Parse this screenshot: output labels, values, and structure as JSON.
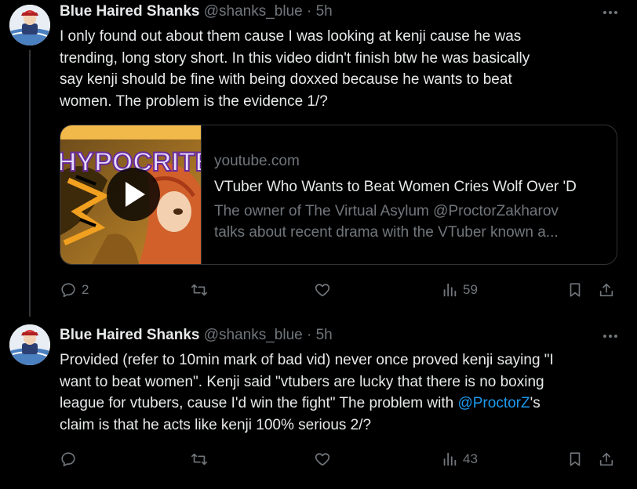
{
  "tweets": [
    {
      "author_name": "Blue Haired Shanks",
      "handle": "@shanks_blue",
      "separator": "·",
      "time": "5h",
      "text_lines": [
        "I only found out about them cause I was looking at kenji cause he was",
        "trending, long story short. In this video didn't finish btw he was basically",
        "say kenji should be fine with being doxxed because he wants to beat",
        "women. The problem is the evidence 1/?"
      ],
      "card": {
        "thumbnail_text": "HYPOCRITE",
        "domain": "youtube.com",
        "title": "VTuber Who Wants to Beat Women Cries Wolf Over 'D",
        "description_lines": [
          "The owner of The Virtual Asylum @ProctorZakharov",
          "talks about recent drama with the VTuber known a..."
        ]
      },
      "replies": "2",
      "retweets": "",
      "likes": "",
      "views": "59"
    },
    {
      "author_name": "Blue Haired Shanks",
      "handle": "@shanks_blue",
      "separator": "·",
      "time": "5h",
      "line1": "Provided (refer to 10min mark of bad vid) never once proved kenji saying \"I",
      "line2": "want to beat women\". Kenji said \"vtubers are lucky that there is no boxing",
      "line3": "league for vtubers, cause I'd win the fight\" The problem with ",
      "mention": "@ProctorZ",
      "line3_after": "'s",
      "line4": "claim is that he acts like kenji 100% serious 2/?",
      "replies": "",
      "retweets": "",
      "likes": "",
      "views": "43"
    }
  ],
  "colors": {
    "background": "#000000",
    "text": "#e7e9ea",
    "secondary": "#71767b",
    "link": "#1d9bf0",
    "border": "#2f3336"
  },
  "icons": [
    "avatar-image",
    "more-icon",
    "reply-icon",
    "retweet-icon",
    "like-icon",
    "views-icon",
    "bookmark-icon",
    "share-icon",
    "play-icon"
  ]
}
